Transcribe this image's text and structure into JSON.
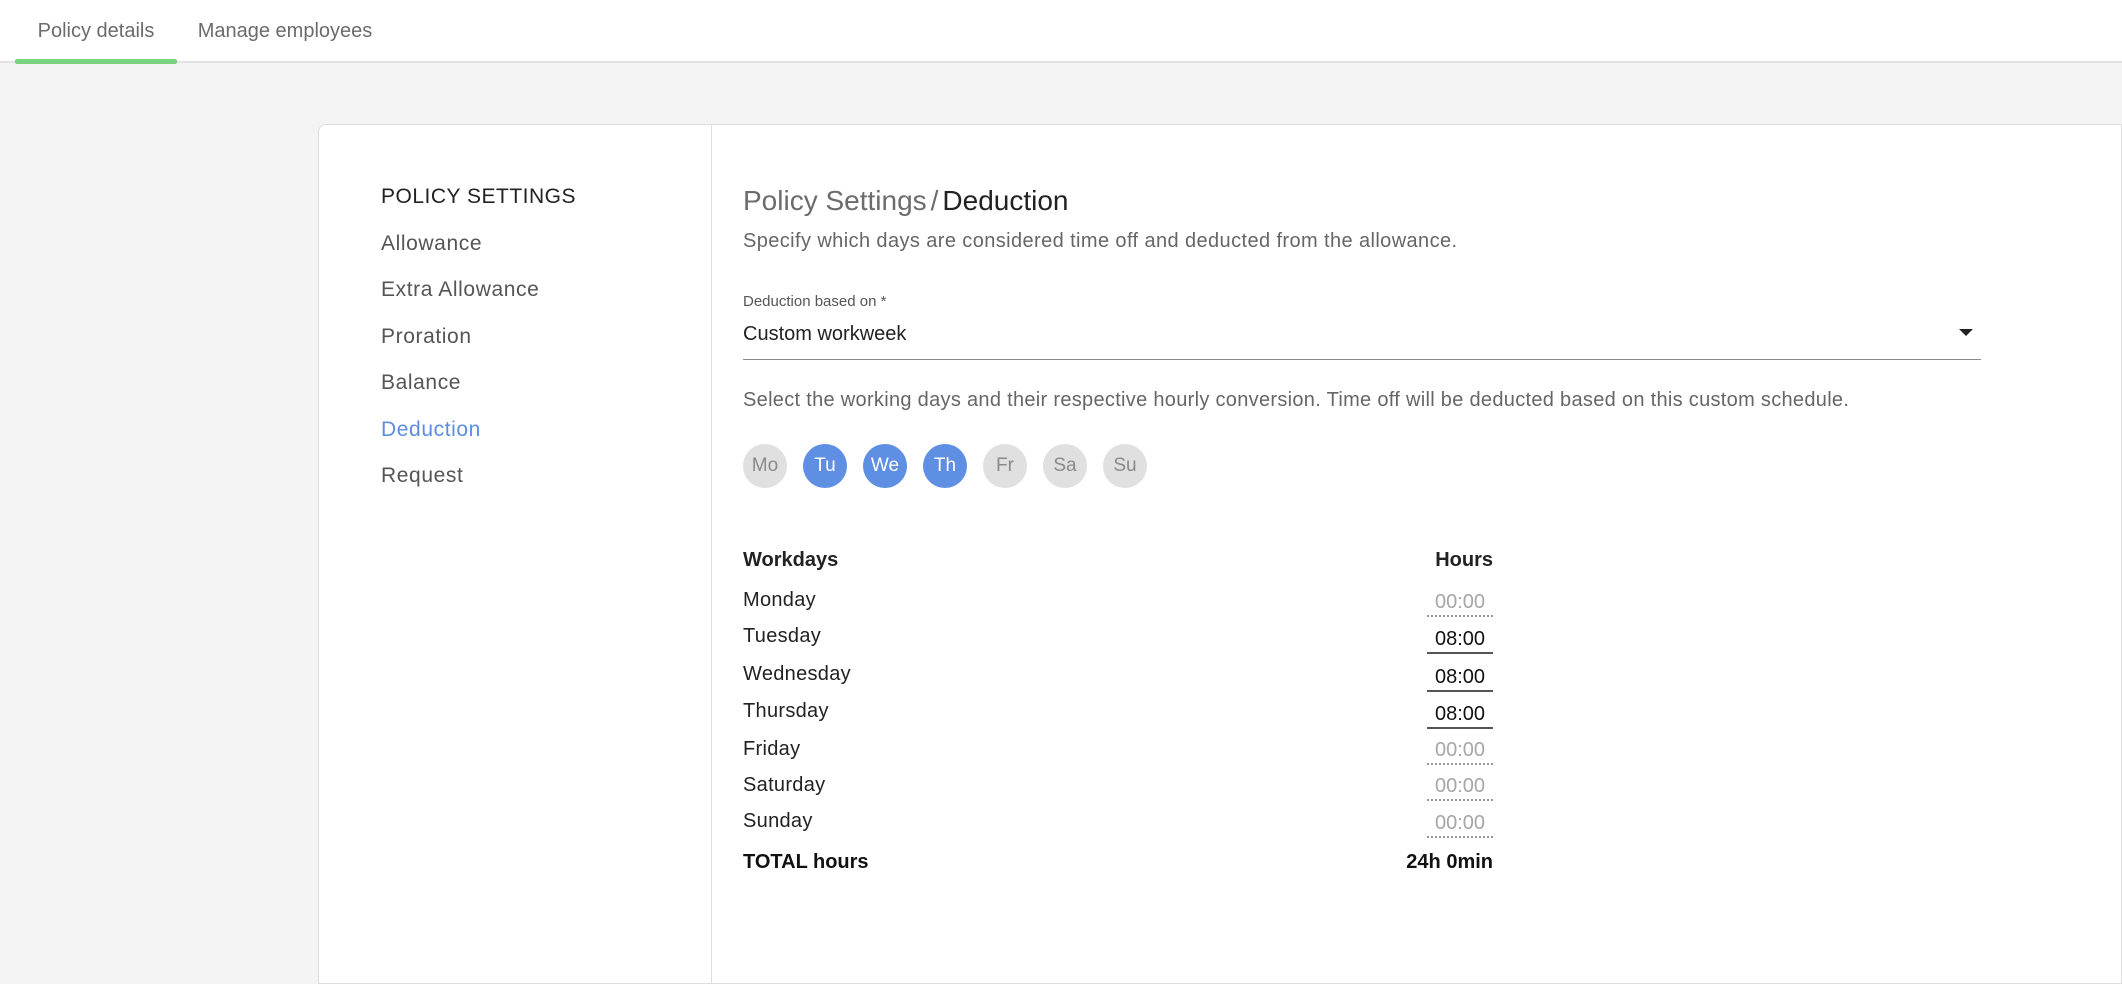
{
  "tabs": [
    {
      "label": "Policy details",
      "active": true
    },
    {
      "label": "Manage employees",
      "active": false
    }
  ],
  "sidebar": {
    "heading": "POLICY SETTINGS",
    "items": [
      {
        "label": "Allowance"
      },
      {
        "label": "Extra Allowance"
      },
      {
        "label": "Proration"
      },
      {
        "label": "Balance"
      },
      {
        "label": "Deduction",
        "active": true
      },
      {
        "label": "Request"
      }
    ]
  },
  "main": {
    "breadcrumb_parent": "Policy Settings",
    "breadcrumb_sep": "/",
    "breadcrumb_current": "Deduction",
    "subtitle": "Specify which days are considered time off and deducted from the allowance.",
    "field_label": "Deduction based on *",
    "field_value": "Custom workweek",
    "description": "Select the working days and their respective hourly conversion. Time off will be deducted based on this custom schedule."
  },
  "days": [
    {
      "label": "Mo",
      "selected": false
    },
    {
      "label": "Tu",
      "selected": true
    },
    {
      "label": "We",
      "selected": true
    },
    {
      "label": "Th",
      "selected": true
    },
    {
      "label": "Fr",
      "selected": false
    },
    {
      "label": "Sa",
      "selected": false
    },
    {
      "label": "Su",
      "selected": false
    }
  ],
  "table": {
    "col_workdays": "Workdays",
    "col_hours": "Hours",
    "rows": [
      {
        "day": "Monday",
        "hours": "00:00",
        "active": false
      },
      {
        "day": "Tuesday",
        "hours": "08:00",
        "active": true
      },
      {
        "day": "Wednesday",
        "hours": "08:00",
        "active": true
      },
      {
        "day": "Thursday",
        "hours": "08:00",
        "active": true
      },
      {
        "day": "Friday",
        "hours": "00:00",
        "active": false
      },
      {
        "day": "Saturday",
        "hours": "00:00",
        "active": false
      },
      {
        "day": "Sunday",
        "hours": "00:00",
        "active": false
      }
    ],
    "total_label": "TOTAL hours",
    "total_value": "24h 0min"
  },
  "colors": {
    "accent": "#5e8fe2",
    "tab_underline": "#79d47d",
    "background": "#f4f4f4"
  }
}
